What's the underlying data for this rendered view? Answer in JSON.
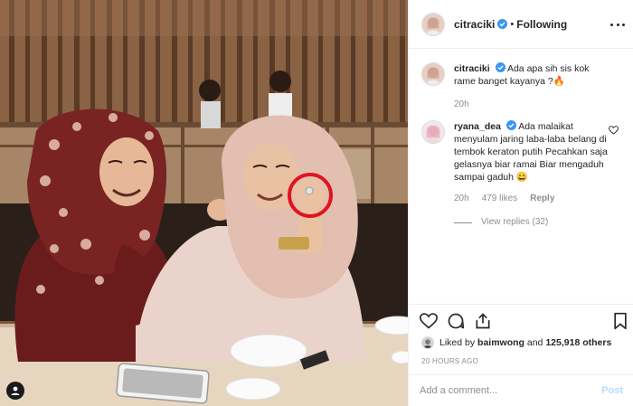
{
  "post": {
    "username": "citraciki",
    "follow_state": "Following",
    "separator": "•"
  },
  "comments": [
    {
      "username": "citraciki",
      "text": "Ada apa sih sis kok rame banget kayanya ?🔥",
      "age": "20h"
    },
    {
      "username": "ryana_dea",
      "text": "Ada malaikat menyulam jaring laba-laba belang di tembok keraton putih Pecahkan saja gelasnya biar ramai Biar mengaduh sampai gaduh 😄",
      "age": "20h",
      "likes": "479 likes",
      "reply_label": "Reply",
      "view_replies": "View replies (32)"
    }
  ],
  "likes": {
    "prefix": "Liked by",
    "first_user": "baimwong",
    "connector": "and",
    "others": "125,918 others"
  },
  "timestamp": "20 HOURS AGO",
  "add_comment": {
    "placeholder": "Add a comment...",
    "post_label": "Post"
  },
  "colors": {
    "verified": "#3897f0",
    "post_disabled": "#b3dbff",
    "muted": "#8e8e8e",
    "annotation_circle": "#e0141e"
  },
  "icons": [
    "more-icon",
    "verified-icon",
    "heart-icon",
    "comment-icon",
    "share-icon",
    "bookmark-icon",
    "user-tag-icon"
  ]
}
